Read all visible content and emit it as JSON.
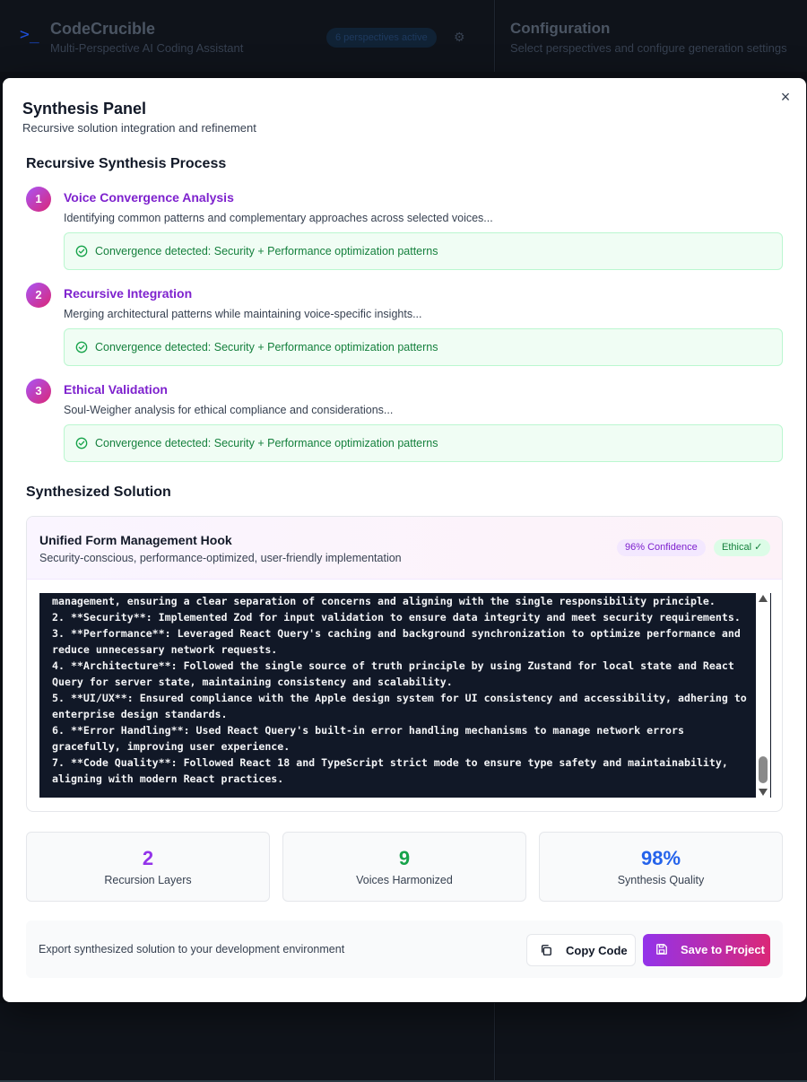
{
  "background": {
    "app_title": "CodeCrucible",
    "app_subtitle": "Multi-Perspective AI Coding Assistant",
    "perspectives_badge": "6 perspectives active",
    "config_title": "Configuration",
    "config_subtitle": "Select perspectives and configure generation settings"
  },
  "modal": {
    "title": "Synthesis Panel",
    "subtitle": "Recursive solution integration and refinement",
    "close_label": "×"
  },
  "process": {
    "title": "Recursive Synthesis Process",
    "steps": [
      {
        "num": "1",
        "title": "Voice Convergence Analysis",
        "desc": "Identifying common patterns and complementary approaches across selected voices...",
        "result": "Convergence detected: Security + Performance optimization patterns"
      },
      {
        "num": "2",
        "title": "Recursive Integration",
        "desc": "Merging architectural patterns while maintaining voice-specific insights...",
        "result": "Convergence detected: Security + Performance optimization patterns"
      },
      {
        "num": "3",
        "title": "Ethical Validation",
        "desc": "Soul-Weigher analysis for ethical compliance and considerations...",
        "result": "Convergence detected: Security + Performance optimization patterns"
      }
    ]
  },
  "solution": {
    "section_title": "Synthesized Solution",
    "title": "Unified Form Management Hook",
    "subtitle": "Security-conscious, performance-optimized, user-friendly implementation",
    "confidence_badge": "96% Confidence",
    "ethical_badge": "Ethical ✓",
    "code_lines": [
      "management, ensuring a clear separation of concerns and aligning with the single responsibility principle.",
      "2. **Security**: Implemented Zod for input validation to ensure data integrity and meet security requirements.",
      "3. **Performance**: Leveraged React Query's caching and background synchronization to optimize performance and",
      "reduce unnecessary network requests.",
      "4. **Architecture**: Followed the single source of truth principle by using Zustand for local state and React",
      "Query for server state, maintaining consistency and scalability.",
      "5. **UI/UX**: Ensured compliance with the Apple design system for UI consistency and accessibility, adhering to",
      "enterprise design standards.",
      "6. **Error Handling**: Used React Query's built-in error handling mechanisms to manage network errors",
      "gracefully, improving user experience.",
      "7. **Code Quality**: Followed React 18 and TypeScript strict mode to ensure type safety and maintainability,",
      "aligning with modern React practices."
    ]
  },
  "stats": [
    {
      "value": "2",
      "label": "Recursion Layers",
      "color": "#9333ea"
    },
    {
      "value": "9",
      "label": "Voices Harmonized",
      "color": "#16a34a"
    },
    {
      "value": "98%",
      "label": "Synthesis Quality",
      "color": "#2563eb"
    }
  ],
  "export": {
    "text": "Export synthesized solution to your development environment",
    "copy_label": "Copy Code",
    "save_label": "Save to Project"
  }
}
